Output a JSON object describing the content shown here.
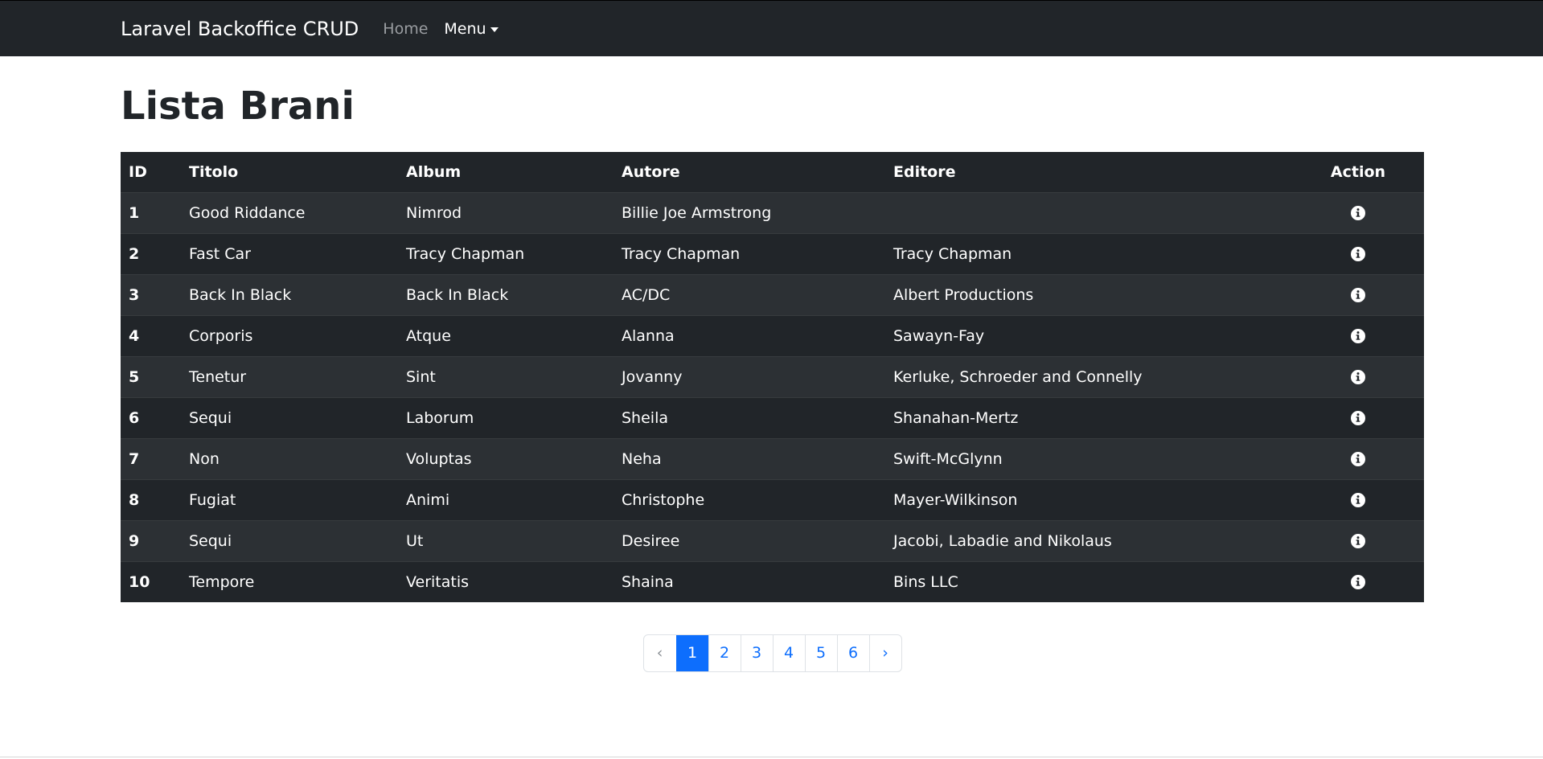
{
  "navbar": {
    "brand": "Laravel Backoffice CRUD",
    "home": "Home",
    "menu": "Menu"
  },
  "page": {
    "title": "Lista Brani"
  },
  "table": {
    "headers": {
      "id": "ID",
      "titolo": "Titolo",
      "album": "Album",
      "autore": "Autore",
      "editore": "Editore",
      "action": "Action"
    },
    "rows": [
      {
        "id": "1",
        "titolo": "Good Riddance",
        "album": "Nimrod",
        "autore": "Billie Joe Armstrong",
        "editore": ""
      },
      {
        "id": "2",
        "titolo": "Fast Car",
        "album": "Tracy Chapman",
        "autore": "Tracy Chapman",
        "editore": "Tracy Chapman"
      },
      {
        "id": "3",
        "titolo": "Back In Black",
        "album": "Back In Black",
        "autore": "AC/DC",
        "editore": "Albert Productions"
      },
      {
        "id": "4",
        "titolo": "Corporis",
        "album": "Atque",
        "autore": "Alanna",
        "editore": "Sawayn-Fay"
      },
      {
        "id": "5",
        "titolo": "Tenetur",
        "album": "Sint",
        "autore": "Jovanny",
        "editore": "Kerluke, Schroeder and Connelly"
      },
      {
        "id": "6",
        "titolo": "Sequi",
        "album": "Laborum",
        "autore": "Sheila",
        "editore": "Shanahan-Mertz"
      },
      {
        "id": "7",
        "titolo": "Non",
        "album": "Voluptas",
        "autore": "Neha",
        "editore": "Swift-McGlynn"
      },
      {
        "id": "8",
        "titolo": "Fugiat",
        "album": "Animi",
        "autore": "Christophe",
        "editore": "Mayer-Wilkinson"
      },
      {
        "id": "9",
        "titolo": "Sequi",
        "album": "Ut",
        "autore": "Desiree",
        "editore": "Jacobi, Labadie and Nikolaus"
      },
      {
        "id": "10",
        "titolo": "Tempore",
        "album": "Veritatis",
        "autore": "Shaina",
        "editore": "Bins LLC"
      }
    ],
    "action_icon": "info-circle-icon"
  },
  "pagination": {
    "prev": "‹",
    "next": "›",
    "pages": [
      "1",
      "2",
      "3",
      "4",
      "5",
      "6"
    ],
    "active": "1"
  },
  "colors": {
    "navbar_bg": "#212529",
    "table_bg": "#212529",
    "table_stripe": "#2c3034",
    "link": "#0d6efd",
    "active_page_bg": "#0d6efd"
  }
}
